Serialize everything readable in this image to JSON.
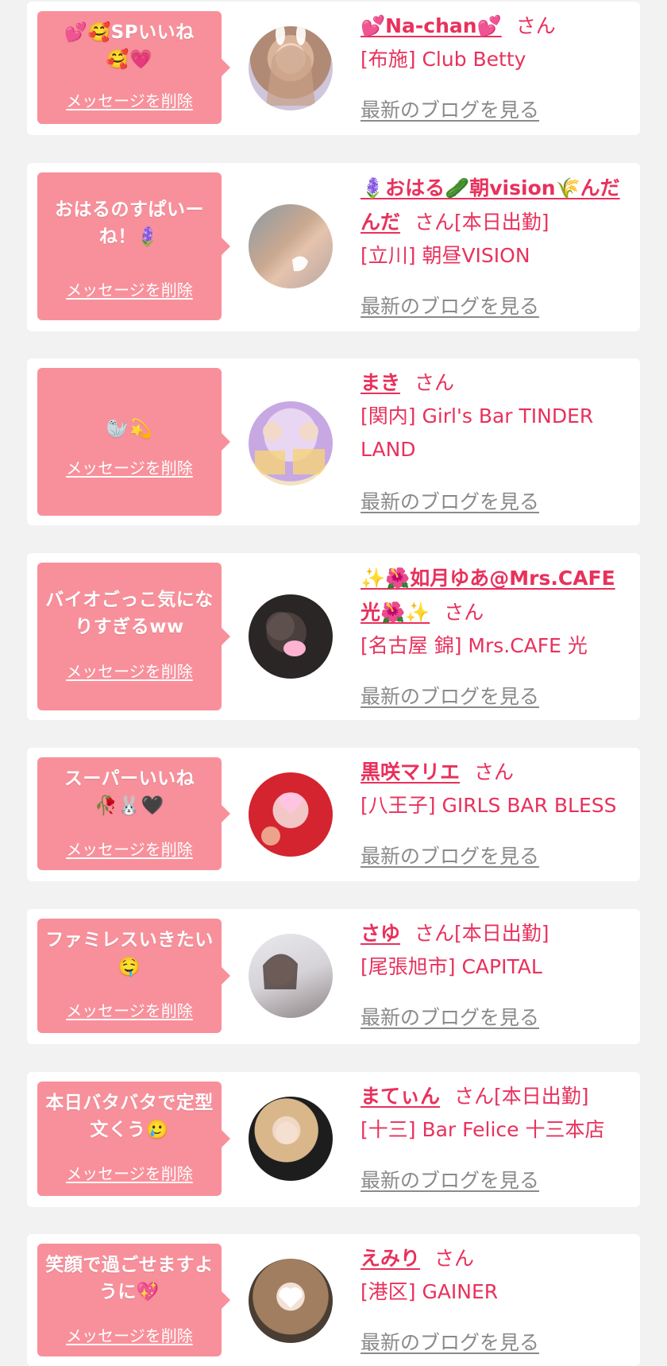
{
  "common": {
    "delete_label": "メッセージを削除",
    "blog_label": "最新のブログを見る",
    "san": "さん"
  },
  "items": [
    {
      "message": "💕🥰SPいいね🥰💗",
      "name": "💕Na-chan💕",
      "status": "",
      "shop": "[布施] Club Betty"
    },
    {
      "message": "おはるのすぱいーね！🪻",
      "name": "🪻おはる🥒朝vision🌾んだんだ",
      "status": "[本日出勤]",
      "shop": "[立川] 朝昼VISION"
    },
    {
      "message": "🦭💫",
      "name": "まき",
      "status": "",
      "shop": "[関内] Girl's Bar TINDER LAND"
    },
    {
      "message": "バイオごっこ気になりすぎるww",
      "name": "✨🌺如月ゆあ@Mrs.CAFE光🌺✨",
      "status": "",
      "shop": "[名古屋 錦] Mrs.CAFE 光"
    },
    {
      "message": "スーパーいいね🥀🐰🖤",
      "name": "黒咲マリエ",
      "status": "",
      "shop": "[八王子] GIRLS BAR BLESS"
    },
    {
      "message": "ファミレスいきたい🤤",
      "name": "さゆ",
      "status": "[本日出勤]",
      "shop": "[尾張旭市] CAPITAL"
    },
    {
      "message": "本日バタバタで定型文くう🥲",
      "name": "まてぃん",
      "status": "[本日出勤]",
      "shop": "[十三] Bar Felice 十三本店"
    },
    {
      "message": "笑顔で過ごせますように💖",
      "name": "えみり",
      "status": "",
      "shop": "[港区] GAINER"
    }
  ],
  "colors": {
    "bubble": "#f8909b",
    "accent": "#e8315c",
    "link_gray": "#8a8a8a",
    "background": "#f2f2f2"
  }
}
